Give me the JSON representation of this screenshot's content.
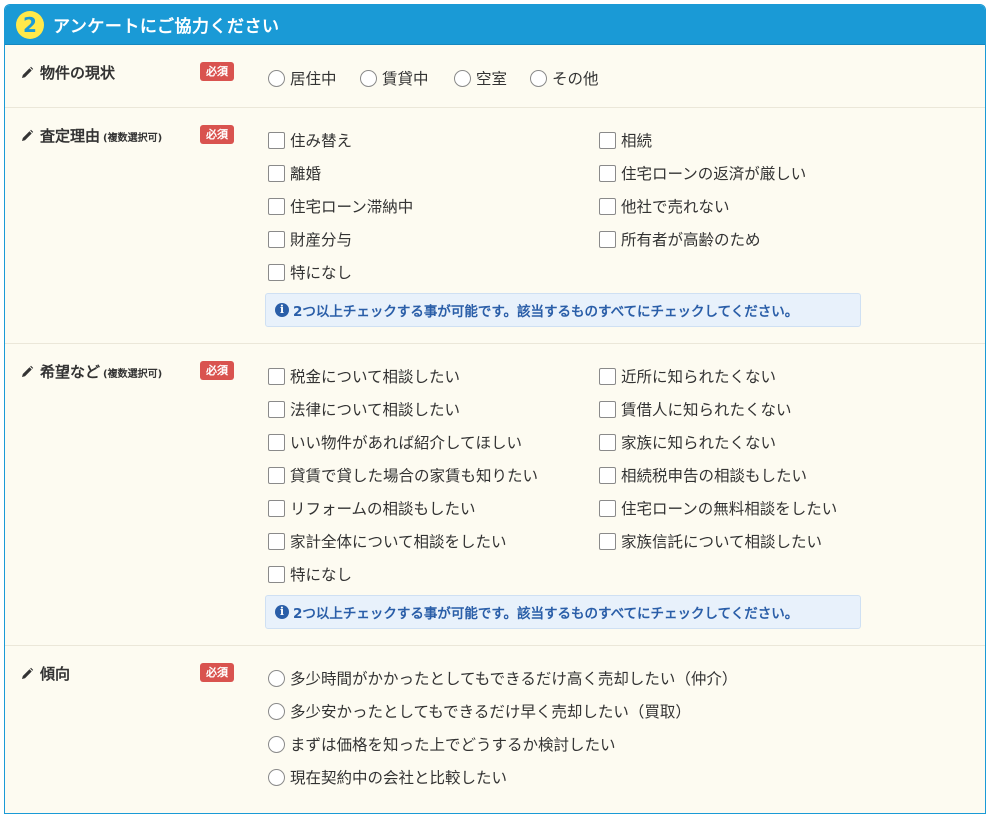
{
  "header": {
    "step": "2",
    "title": "アンケートにご協力ください"
  },
  "required_label": "必須",
  "notice_text": "2つ以上チェックする事が可能です。該当するものすべてにチェックしてください。",
  "property_status": {
    "label": "物件の現状",
    "options": [
      "居住中",
      "賃貸中",
      "空室",
      "その他"
    ]
  },
  "assessment_reason": {
    "label": "査定理由",
    "sub": "(複数選択可)",
    "options_left": [
      "住み替え",
      "離婚",
      "住宅ローン滞納中",
      "財産分与",
      "特になし"
    ],
    "options_right": [
      "相続",
      "住宅ローンの返済が厳しい",
      "他社で売れない",
      "所有者が高齢のため"
    ]
  },
  "requests": {
    "label": "希望など",
    "sub": "(複数選択可)",
    "options_left": [
      "税金について相談したい",
      "法律について相談したい",
      "いい物件があれば紹介してほしい",
      "貸賃で貸した場合の家賃も知りたい",
      "リフォームの相談もしたい",
      "家計全体について相談をしたい",
      "特になし"
    ],
    "options_right": [
      "近所に知られたくない",
      "賃借人に知られたくない",
      "家族に知られたくない",
      "相続税申告の相談もしたい",
      "住宅ローンの無料相談をしたい",
      "家族信託について相談したい"
    ]
  },
  "tendency": {
    "label": "傾向",
    "options": [
      "多少時間がかかったとしてもできるだけ高く売却したい（仲介）",
      "多少安かったとしてもできるだけ早く売却したい（買取）",
      "まずは価格を知った上でどうするか検討したい",
      "現在契約中の会社と比較したい"
    ]
  },
  "colors": {
    "header_bg": "#1a9ad6",
    "panel_bg": "#fdfbf1",
    "required_bg": "#d9534f",
    "notice_text": "#2a5ea8"
  }
}
